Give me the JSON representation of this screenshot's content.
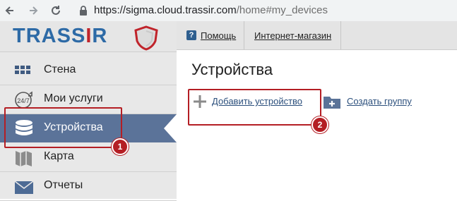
{
  "browser": {
    "url_host": "https://sigma.cloud.trassir.com",
    "url_path": "/home#my_devices"
  },
  "logo": {
    "text": "TRASSIR"
  },
  "sidebar": {
    "items": [
      {
        "label": "Стена",
        "icon": "grid-icon"
      },
      {
        "label": "Мои услуги",
        "icon": "24-7-icon"
      },
      {
        "label": "Устройства",
        "icon": "database-icon",
        "active": true
      },
      {
        "label": "Карта",
        "icon": "map-icon"
      },
      {
        "label": "Отчеты",
        "icon": "envelope-icon"
      }
    ]
  },
  "topbar": {
    "help_label": "Помощь",
    "help_icon_glyph": "?",
    "shop_label": "Интернет-магазин"
  },
  "main": {
    "title": "Устройства",
    "add_device_label": "Добавить устройство",
    "create_group_label": "Создать группу"
  },
  "annotations": {
    "badge_1": "1",
    "badge_2": "2",
    "color": "#b41e24"
  },
  "colors": {
    "active_item": "#5b7399",
    "brand_blue": "#2d6aa6",
    "brand_red": "#c0242b"
  }
}
